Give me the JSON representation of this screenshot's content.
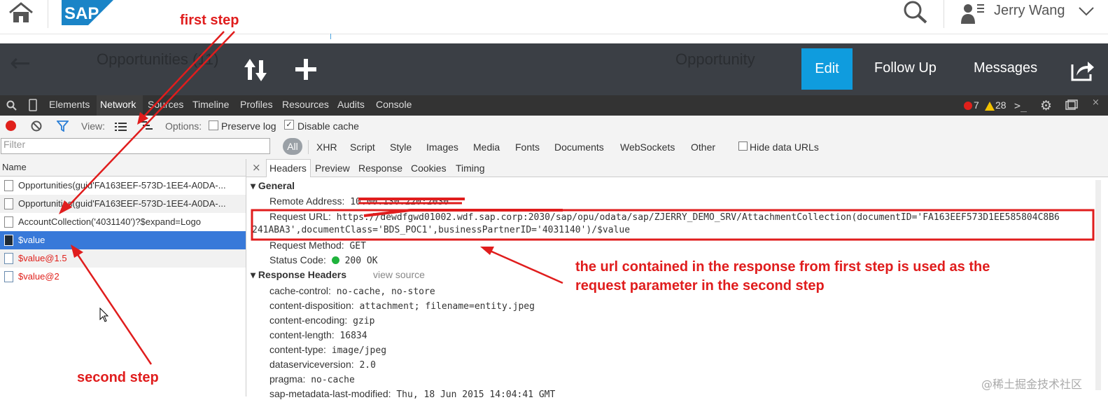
{
  "shell": {
    "user_name": "Jerry Wang",
    "logo_text": "SAP"
  },
  "appbar": {
    "left_title": "Opportunities (11)",
    "right_title": "Opportunity",
    "edit_label": "Edit",
    "followup_label": "Follow Up",
    "messages_label": "Messages"
  },
  "devtools": {
    "tabs": [
      "Elements",
      "Network",
      "Sources",
      "Timeline",
      "Profiles",
      "Resources",
      "Audits",
      "Console"
    ],
    "error_count": "7",
    "warning_count": "28"
  },
  "toolbar": {
    "view_label": "View:",
    "options_label": "Options:",
    "preserve_log": "Preserve log",
    "disable_cache": "Disable cache"
  },
  "filter": {
    "placeholder": "Filter",
    "types": [
      "All",
      "XHR",
      "Script",
      "Style",
      "Images",
      "Media",
      "Fonts",
      "Documents",
      "WebSockets",
      "Other"
    ],
    "hide_data_urls": "Hide data URLs"
  },
  "requests": {
    "header": "Name",
    "items": [
      {
        "label": "Opportunities(guid'FA163EEF-573D-1EE4-A0DA-..."
      },
      {
        "label": "Opportunities(guid'FA163EEF-573D-1EE4-A0DA-..."
      },
      {
        "label": "AccountCollection('4031140')?$expand=Logo"
      },
      {
        "label": "$value"
      },
      {
        "label": "$value@1.5"
      },
      {
        "label": "$value@2"
      }
    ]
  },
  "detail": {
    "tabs": [
      "Headers",
      "Preview",
      "Response",
      "Cookies",
      "Timing"
    ],
    "general_title": "General",
    "remote_address_key": "Remote Address:",
    "remote_address_val": "10.00.130.220:2030",
    "request_url_key": "Request URL:",
    "request_url_line1": "https://dewdfgwd01002.wdf.sap.corp:2030/sap/opu/odata/sap/ZJERRY_DEMO_SRV/AttachmentCollection(documentID='FA163EEF573D1EE585804C8B6",
    "request_url_line2": "241ABA3',documentClass='BDS_POC1',businessPartnerID='4031140')/$value",
    "request_method_key": "Request Method:",
    "request_method_val": "GET",
    "status_code_key": "Status Code:",
    "status_code_val": "200 OK",
    "response_headers_title": "Response Headers",
    "view_source": "view source",
    "response_headers": [
      {
        "k": "cache-control:",
        "v": "no-cache, no-store"
      },
      {
        "k": "content-disposition:",
        "v": "attachment; filename=entity.jpeg"
      },
      {
        "k": "content-encoding:",
        "v": "gzip"
      },
      {
        "k": "content-length:",
        "v": "16834"
      },
      {
        "k": "content-type:",
        "v": "image/jpeg"
      },
      {
        "k": "dataserviceversion:",
        "v": "2.0"
      },
      {
        "k": "pragma:",
        "v": "no-cache"
      },
      {
        "k": "sap-metadata-last-modified:",
        "v": "Thu, 18 Jun 2015 14:04:41 GMT"
      }
    ]
  },
  "annotations": {
    "first_step": "first step",
    "second_step": "second step",
    "explanation_line1": "the url contained in the response from first step is used as the",
    "explanation_line2": "request parameter in the second step",
    "watermark": "@稀土掘金技术社区"
  },
  "colors": {
    "annotation_red": "#e01d1d",
    "selected_blue": "#3879d9",
    "edit_blue": "#0f9cde",
    "appbar_dark": "#3b3f45"
  }
}
